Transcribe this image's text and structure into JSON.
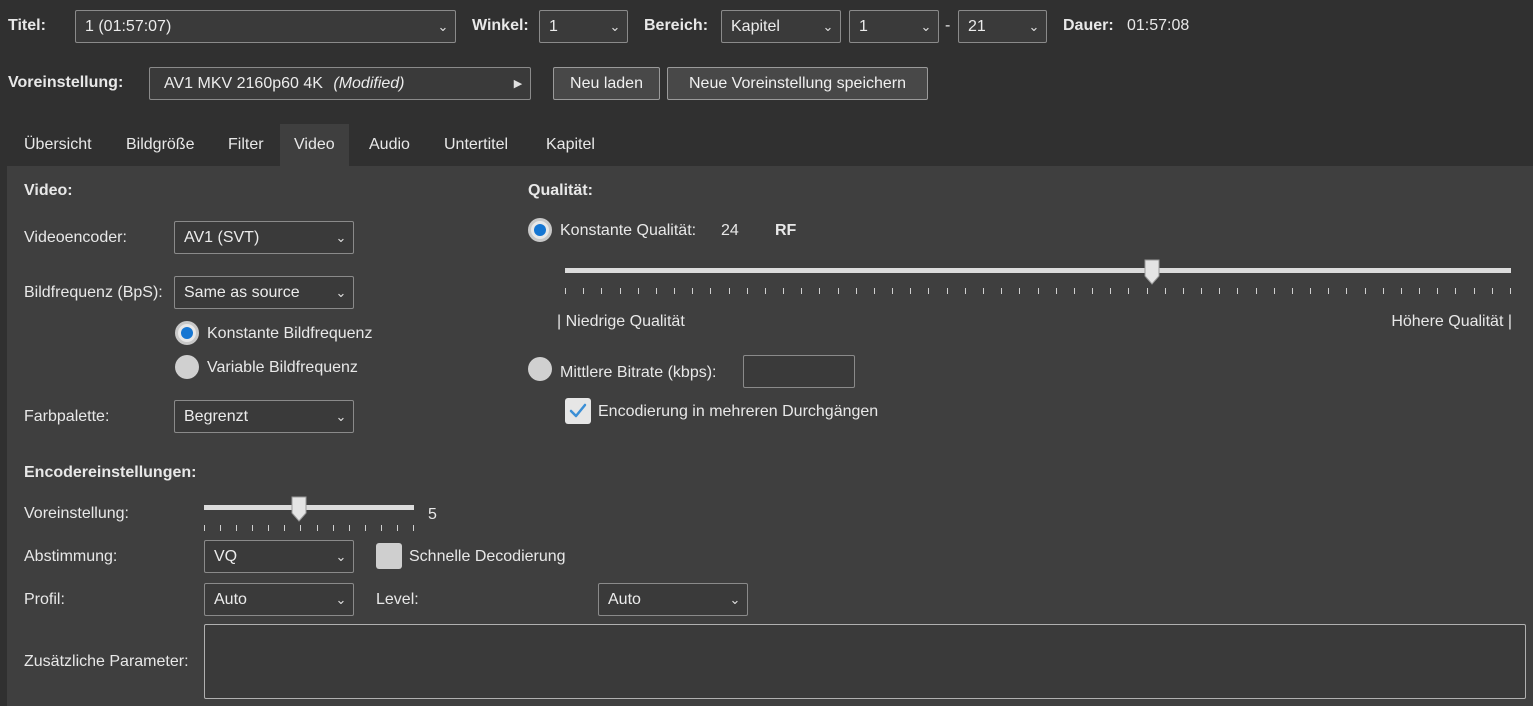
{
  "header": {
    "title_label": "Titel:",
    "title_value": "1  (01:57:07)",
    "angle_label": "Winkel:",
    "angle_value": "1",
    "range_label": "Bereich:",
    "range_type": "Kapitel",
    "range_start": "1",
    "range_sep": "-",
    "range_end": "21",
    "duration_label": "Dauer:",
    "duration_value": "01:57:08"
  },
  "preset": {
    "label": "Voreinstellung:",
    "name": "AV1 MKV 2160p60 4K",
    "modified": "(Modified)",
    "reload_label": "Neu laden",
    "save_label": "Neue Voreinstellung speichern"
  },
  "tabs": [
    "Übersicht",
    "Bildgröße",
    "Filter",
    "Video",
    "Audio",
    "Untertitel",
    "Kapitel"
  ],
  "active_tab": "Video",
  "video": {
    "heading": "Video:",
    "encoder_label": "Videoencoder:",
    "encoder_value": "AV1 (SVT)",
    "framerate_label": "Bildfrequenz (BpS):",
    "framerate_value": "Same as source",
    "cfr_label": "Konstante Bildfrequenz",
    "vfr_label": "Variable Bildfrequenz",
    "framerate_mode": "constant",
    "palette_label": "Farbpalette:",
    "palette_value": "Begrenzt"
  },
  "quality": {
    "heading": "Qualität:",
    "cq_label": "Konstante Qualität:",
    "cq_value": "24",
    "cq_unit": "RF",
    "slider_fraction": 0.62,
    "low_label": "| Niedrige Qualität",
    "high_label": "Höhere Qualität |",
    "bitrate_label": "Mittlere Bitrate (kbps):",
    "bitrate_value": "",
    "multipass_label": "Encodierung in mehreren Durchgängen",
    "multipass_checked": true,
    "mode": "constant_quality"
  },
  "encoder_settings": {
    "heading": "Encodereinstellungen:",
    "preset_label": "Voreinstellung:",
    "preset_value": "5",
    "preset_fraction": 0.45,
    "tune_label": "Abstimmung:",
    "tune_value": "VQ",
    "fastdecode_label": "Schnelle Decodierung",
    "fastdecode_checked": false,
    "profile_label": "Profil:",
    "profile_value": "Auto",
    "level_label": "Level:",
    "level_value": "Auto",
    "extra_label": "Zusätzliche Parameter:",
    "extra_value": ""
  },
  "colors": {
    "background": "#303030",
    "panel": "#3f3f3f",
    "accent": "#1676d2"
  },
  "icons": {
    "dropdown": "chevron-down-icon",
    "submenu": "triangle-right-icon",
    "check": "checkmark-icon"
  }
}
